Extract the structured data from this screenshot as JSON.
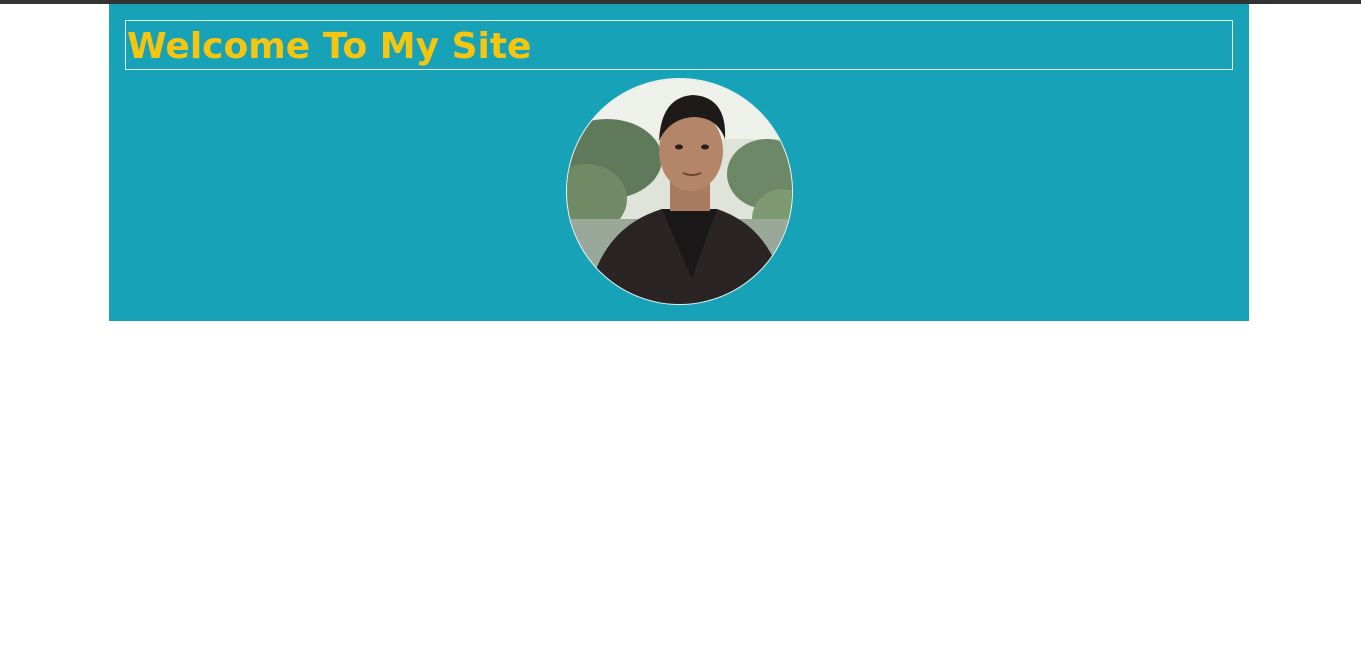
{
  "page": {
    "background_color": "#ffffff",
    "top_border_color": "#333333"
  },
  "header": {
    "background_color": "#18a2b8",
    "title": "Welcome To My Site",
    "title_color": "#f5c60f"
  },
  "profile": {
    "image_description_icon": "profile-photo"
  }
}
